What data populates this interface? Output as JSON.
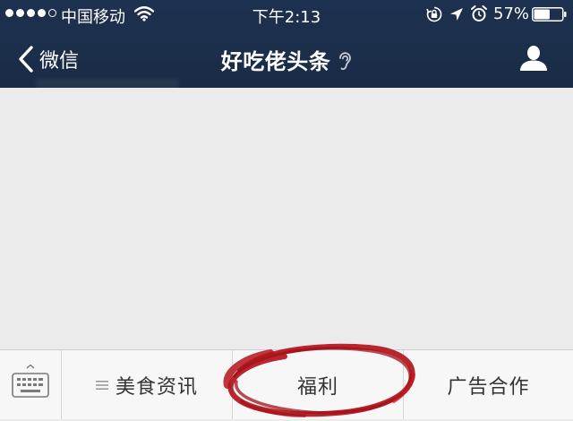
{
  "status_bar": {
    "carrier": "中国移动",
    "time": "下午2:13",
    "battery": "57%",
    "signal_bars_filled": 4,
    "signal_bars_total": 5,
    "battery_level": 0.57
  },
  "nav": {
    "back_label": "微信",
    "title": "好吃佬头条"
  },
  "menu": {
    "items": [
      {
        "label": "美食资讯",
        "has_submenu": true
      },
      {
        "label": "福利",
        "has_submenu": false
      },
      {
        "label": "广告合作",
        "has_submenu": false
      }
    ]
  },
  "colors": {
    "header_bg": "#1b2e4a",
    "content_bg": "#ebebeb",
    "menu_bg": "#f7f7f7",
    "annotation_red": "#b3141b"
  }
}
